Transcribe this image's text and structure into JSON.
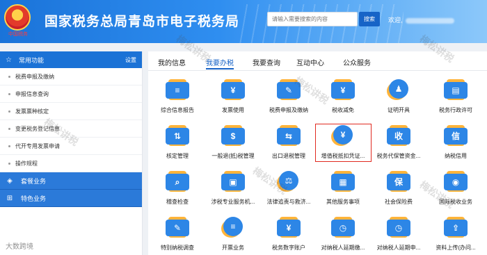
{
  "header": {
    "emblem_text": "中国税务",
    "title": "国家税务总局青岛市电子税务局",
    "search": {
      "placeholder": "请输入需要搜索的内容",
      "button_label": "搜索"
    },
    "welcome": "欢迎,"
  },
  "sidebar": {
    "common": {
      "title": "常用功能",
      "settings_label": "设置"
    },
    "items": [
      {
        "label": "税费申报及缴纳"
      },
      {
        "label": "申报信息查询"
      },
      {
        "label": "发票票种核定"
      },
      {
        "label": "变更税务登记信息"
      },
      {
        "label": "代开专用发票申请"
      },
      {
        "label": "操作规程"
      }
    ],
    "groups": [
      {
        "label": "套餐业务",
        "icon": "layers-icon"
      },
      {
        "label": "特色业务",
        "icon": "grid-icon"
      }
    ]
  },
  "main": {
    "tabs": [
      {
        "label": "我的信息"
      },
      {
        "label": "我要办税",
        "active": true
      },
      {
        "label": "我要查询"
      },
      {
        "label": "互动中心"
      },
      {
        "label": "公众服务"
      }
    ],
    "services": [
      {
        "label": "综合信息报告",
        "icon": "report-icon",
        "glyph": "≡"
      },
      {
        "label": "发票使用",
        "icon": "invoice-icon",
        "glyph": "¥"
      },
      {
        "label": "税费申报及缴纳",
        "icon": "declare-icon",
        "glyph": "✎"
      },
      {
        "label": "税收减免",
        "icon": "reduction-icon",
        "glyph": "¥"
      },
      {
        "label": "证明开具",
        "icon": "certificate-icon",
        "glyph": "♟"
      },
      {
        "label": "税务行政许可",
        "icon": "permit-icon",
        "glyph": "▤"
      },
      {
        "label": "核定管理",
        "icon": "assess-icon",
        "glyph": "⇅"
      },
      {
        "label": "一般退(抵)税管理",
        "icon": "refund-icon",
        "glyph": "$"
      },
      {
        "label": "出口退税管理",
        "icon": "export-refund-icon",
        "glyph": "⇆"
      },
      {
        "label": "增值税抵扣凭证...",
        "icon": "vat-voucher-icon",
        "glyph": "¥"
      },
      {
        "label": "税务代保管资金...",
        "icon": "custody-icon",
        "glyph": "收"
      },
      {
        "label": "纳税信用",
        "icon": "credit-icon",
        "glyph": "信"
      },
      {
        "label": "稽查检查",
        "icon": "inspection-icon",
        "glyph": "⌕"
      },
      {
        "label": "涉税专业服务机...",
        "icon": "agency-icon",
        "glyph": "▣"
      },
      {
        "label": "法律追责与救济...",
        "icon": "legal-icon",
        "glyph": "⚖"
      },
      {
        "label": "其他服务事项",
        "icon": "other-services-icon",
        "glyph": "▦"
      },
      {
        "label": "社会保险费",
        "icon": "social-insurance-icon",
        "glyph": "保"
      },
      {
        "label": "国际税收业务",
        "icon": "globe-icon",
        "glyph": "◉"
      },
      {
        "label": "特别纳税调查",
        "icon": "special-survey-icon",
        "glyph": "✎"
      },
      {
        "label": "开票业务",
        "icon": "issue-invoice-icon",
        "glyph": "≡"
      },
      {
        "label": "税务数字账户",
        "icon": "digital-account-icon",
        "glyph": "¥"
      },
      {
        "label": "对纳税人延期缴...",
        "icon": "defer-payment-icon",
        "glyph": "◷"
      },
      {
        "label": "对纳税人延期申...",
        "icon": "defer-declare-icon",
        "glyph": "◷"
      },
      {
        "label": "资料上传(办问...",
        "icon": "upload-icon",
        "glyph": "⇪"
      }
    ]
  },
  "watermark_text": "梅松讲税",
  "corner_watermark": "大数跨境",
  "colors": {
    "primary": "#1b72d6",
    "accent_orange": "#ffb43b",
    "highlight_red": "#e0291f"
  }
}
